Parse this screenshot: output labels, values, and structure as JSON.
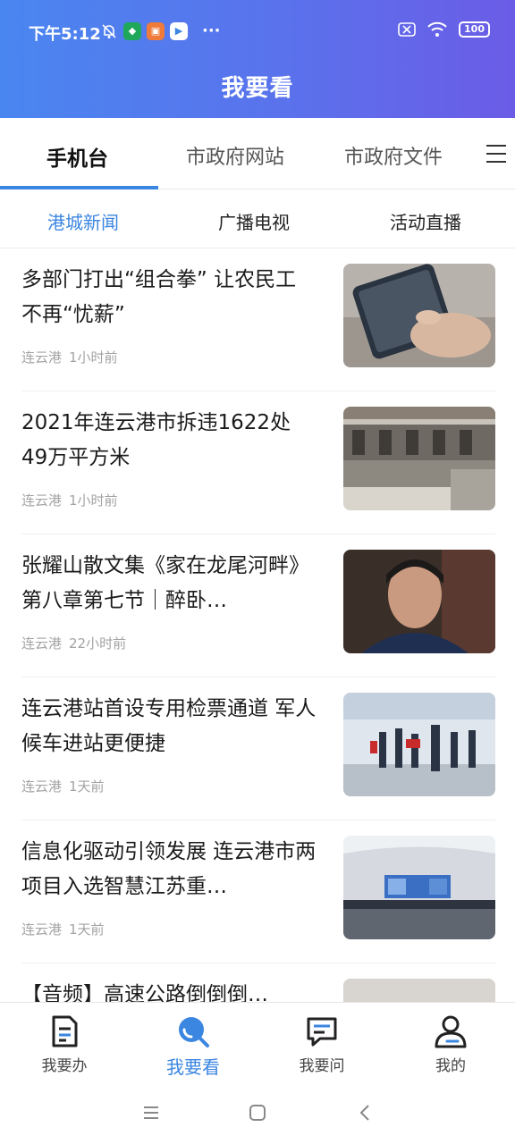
{
  "status_bar": {
    "time": "下午5:12",
    "battery": "100",
    "dots": "···"
  },
  "header": {
    "title": "我要看"
  },
  "tabs": [
    {
      "label": "手机台",
      "active": true
    },
    {
      "label": "市政府网站",
      "active": false
    },
    {
      "label": "市政府文件",
      "active": false
    }
  ],
  "subtabs": [
    {
      "label": "港城新闻",
      "active": true
    },
    {
      "label": "广播电视",
      "active": false
    },
    {
      "label": "活动直播",
      "active": false
    }
  ],
  "news": [
    {
      "title": "多部门打出“组合拳” 让农民工不再“忧薪”",
      "source": "连云港",
      "time": "1小时前",
      "image": "hand-phone-photo"
    },
    {
      "title": "2021年连云港市拆违1622处49万平方米",
      "source": "连云港",
      "time": "1小时前",
      "image": "demolition-building-photo"
    },
    {
      "title": "张耀山散文集《家在龙尾河畔》第八章第七节｜醉卧…",
      "source": "连云港",
      "time": "22小时前",
      "image": "man-portrait-photo"
    },
    {
      "title": "连云港站首设专用检票通道 军人候车进站更便捷",
      "source": "连云港",
      "time": "1天前",
      "image": "station-hall-photo"
    },
    {
      "title": "信息化驱动引领发展 连云港市两项目入选智慧江苏重…",
      "source": "连云港",
      "time": "1天前",
      "image": "control-room-photo"
    },
    {
      "title": "【音频】高速公路倒倒倒…",
      "source": "",
      "time": "",
      "image": "highway-photo"
    }
  ],
  "bottom_nav": [
    {
      "label": "我要办",
      "icon": "document-icon",
      "active": false
    },
    {
      "label": "我要看",
      "icon": "watch-search-icon",
      "active": true
    },
    {
      "label": "我要问",
      "icon": "chat-icon",
      "active": false
    },
    {
      "label": "我的",
      "icon": "user-icon",
      "active": false
    }
  ],
  "colors": {
    "accent": "#3b86e0",
    "header_start": "#4a86f0",
    "header_end": "#6b5ce6"
  }
}
